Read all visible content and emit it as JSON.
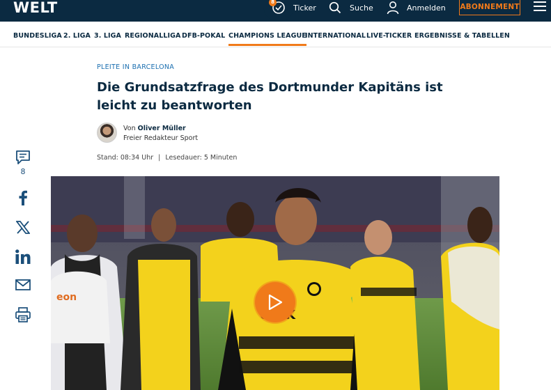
{
  "header": {
    "logo": "WELT",
    "ticker_badge": "8",
    "ticker_label": "Ticker",
    "search_label": "Suche",
    "login_label": "Anmelden",
    "subscribe_label": "ABONNEMENT"
  },
  "nav": {
    "items": [
      {
        "label": "BUNDESLIGA"
      },
      {
        "label": "2. LIGA"
      },
      {
        "label": "3. LIGA"
      },
      {
        "label": "REGIONALLIGA"
      },
      {
        "label": "DFB-POKAL"
      },
      {
        "label": "CHAMPIONS LEAGUE"
      },
      {
        "label": "INTERNATIONAL"
      },
      {
        "label": "LIVE-TICKER"
      },
      {
        "label": "ERGEBNISSE & TABELLEN"
      }
    ],
    "active": "CHAMPIONS LEAGUE"
  },
  "article": {
    "kicker": "PLEITE IN BARCELONA",
    "headline": "Die Grundsatzfrage des Dortmunder Kapitäns ist leicht zu beantworten",
    "author_prefix": "Von",
    "author_name": "Oliver Müller",
    "author_role": "Freier Redakteur Sport",
    "stand_label": "Stand: 08:34 Uhr",
    "separator": "|",
    "reading_time": "Lesedauer: 5 Minuten"
  },
  "social": {
    "comment_count": "8",
    "icons": [
      "comment-icon",
      "facebook-icon",
      "x-icon",
      "linkedin-icon",
      "mail-icon",
      "print-icon"
    ]
  },
  "hero": {
    "jersey_text": "ONIK",
    "jersey_text_left": "eon"
  },
  "colors": {
    "brand_navy": "#0b2a41",
    "accent_orange": "#f07a1a",
    "kicker_blue": "#1b6fb0",
    "jersey_yellow": "#f3d21c"
  }
}
